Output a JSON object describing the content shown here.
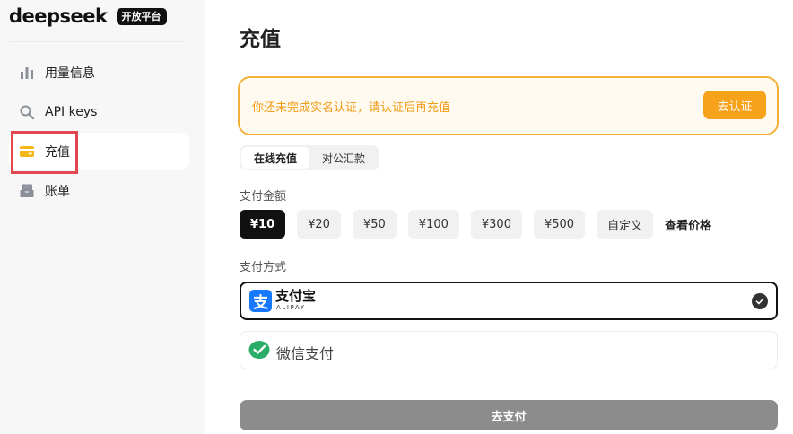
{
  "brand": {
    "word": "deepseek",
    "badge": "开放平台"
  },
  "sidebar": {
    "items": [
      {
        "label": "用量信息",
        "icon": "bar-chart-icon"
      },
      {
        "label": "API keys",
        "icon": "search-icon"
      },
      {
        "label": "充值",
        "icon": "card-icon",
        "active": true
      },
      {
        "label": "账单",
        "icon": "inbox-icon"
      }
    ]
  },
  "main": {
    "title": "充值",
    "alert": {
      "text": "你还未完成实名认证，请认证后再充值",
      "button": "去认证"
    },
    "tabs": [
      {
        "label": "在线充值",
        "active": true
      },
      {
        "label": "对公汇款",
        "active": false
      }
    ],
    "amount_label": "支付金额",
    "amounts": [
      "¥10",
      "¥20",
      "¥50",
      "¥100",
      "¥300",
      "¥500",
      "自定义"
    ],
    "selected_amount": "¥10",
    "price_link": "查看价格",
    "payment_label": "支付方式",
    "payments": {
      "alipay": {
        "name": "支付宝",
        "sub": "ALIPAY"
      },
      "wechat": {
        "name": "微信支付"
      }
    },
    "pay_button": "去支付"
  },
  "colors": {
    "accent_orange": "#f7a21b",
    "alert_border": "#f3b13a",
    "highlight_red": "#e2474f",
    "alipay_blue": "#1677ff",
    "wechat_green": "#2aae67"
  }
}
